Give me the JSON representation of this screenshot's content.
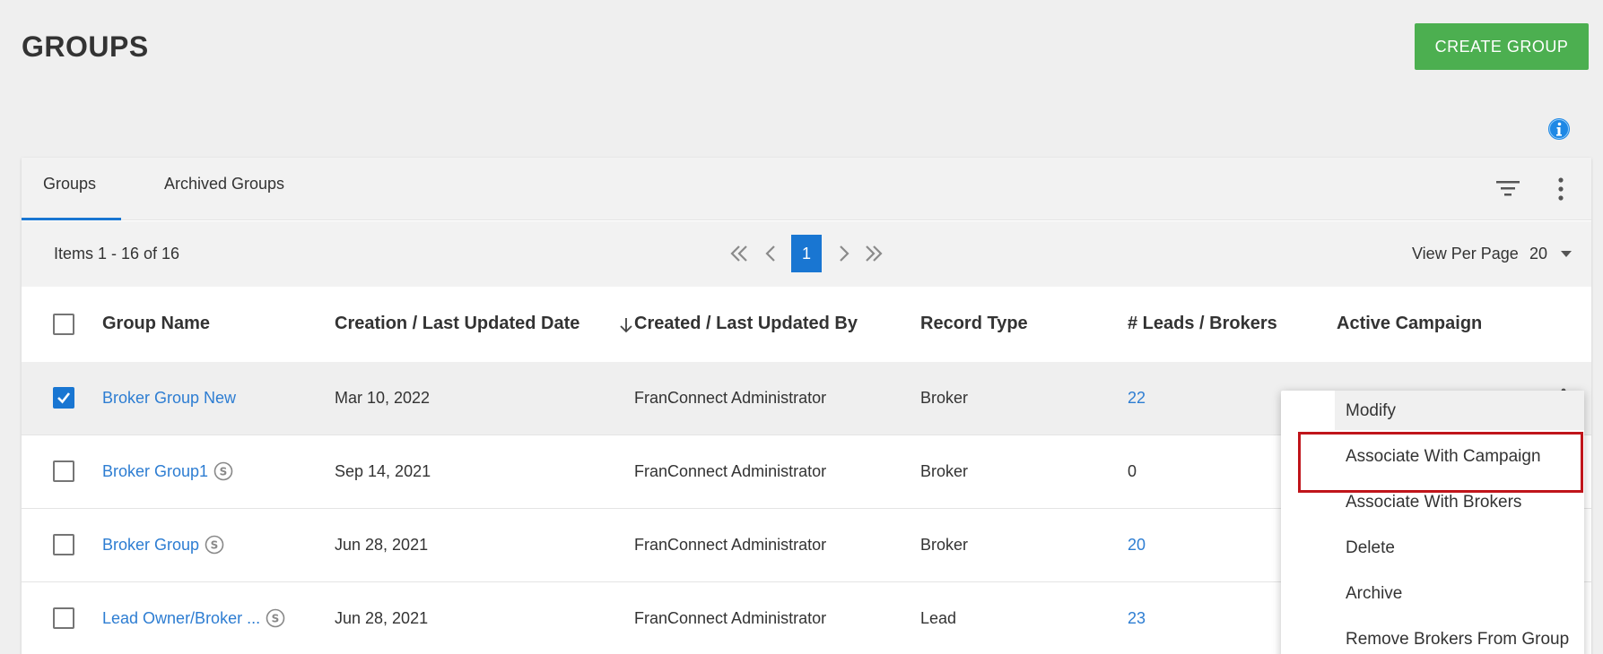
{
  "page": {
    "title": "GROUPS",
    "create_button": "CREATE GROUP"
  },
  "icons": {
    "info": "info-icon",
    "filter": "filter-icon",
    "more": "more-vert-icon"
  },
  "tabs": [
    {
      "label": "Groups",
      "active": true
    },
    {
      "label": "Archived Groups",
      "active": false
    }
  ],
  "pager": {
    "items_text": "Items 1 - 16 of 16",
    "current_page": "1",
    "view_per_page_label": "View Per Page",
    "view_per_page_value": "20"
  },
  "table": {
    "columns": [
      "Group Name",
      "Creation / Last Updated Date",
      "Created / Last Updated By",
      "Record Type",
      "# Leads / Brokers",
      "Active Campaign"
    ],
    "rows": [
      {
        "name": "Broker Group New",
        "date": "Mar 10, 2022",
        "by": "FranConnect Administrator",
        "type": "Broker",
        "count": "22",
        "count_link": true,
        "checked": true,
        "s_badge": false
      },
      {
        "name": "Broker Group1",
        "date": "Sep 14, 2021",
        "by": "FranConnect Administrator",
        "type": "Broker",
        "count": "0",
        "count_link": false,
        "checked": false,
        "s_badge": true
      },
      {
        "name": "Broker Group",
        "date": "Jun 28, 2021",
        "by": "FranConnect Administrator",
        "type": "Broker",
        "count": "20",
        "count_link": true,
        "checked": false,
        "s_badge": true
      },
      {
        "name": "Lead Owner/Broker ...",
        "date": "Jun 28, 2021",
        "by": "FranConnect Administrator",
        "type": "Lead",
        "count": "23",
        "count_link": true,
        "checked": false,
        "s_badge": true
      }
    ]
  },
  "context_menu": {
    "items": [
      "Modify",
      "Associate With Campaign",
      "Associate With Brokers",
      "Delete",
      "Archive",
      "Remove Brokers From Group"
    ],
    "highlighted": "Associate With Campaign"
  },
  "colors": {
    "accent": "#1976d2",
    "create_button": "#4caf50",
    "highlight_border": "#c0151b",
    "link": "#2d7dd2"
  }
}
